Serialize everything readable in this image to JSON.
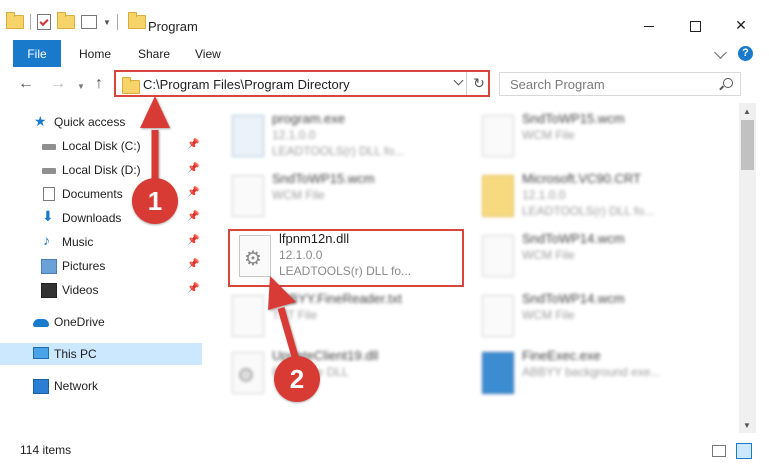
{
  "window": {
    "title": "Program",
    "controls": {
      "minimize": "",
      "maximize": "",
      "close": "✕"
    }
  },
  "ribbon": {
    "tabs": [
      "File",
      "Home",
      "Share",
      "View"
    ],
    "help": "?"
  },
  "navigation": {
    "back": "←",
    "forward": "→",
    "up": "↑",
    "address": "C:\\Program Files\\Program Directory",
    "refresh": "↻",
    "search_placeholder": "Search Program"
  },
  "sidebar": {
    "items": [
      {
        "label": "Quick access",
        "icon": "star-icon",
        "pinned": false
      },
      {
        "label": "Local Disk (C:)",
        "icon": "disk-icon",
        "pinned": true
      },
      {
        "label": "Local Disk (D:)",
        "icon": "disk-icon",
        "pinned": true
      },
      {
        "label": "Documents",
        "icon": "documents-icon",
        "pinned": true
      },
      {
        "label": "Downloads",
        "icon": "downloads-icon",
        "pinned": true
      },
      {
        "label": "Music",
        "icon": "music-icon",
        "pinned": true
      },
      {
        "label": "Pictures",
        "icon": "pictures-icon",
        "pinned": true
      },
      {
        "label": "Videos",
        "icon": "videos-icon",
        "pinned": true
      },
      {
        "label": "OneDrive",
        "icon": "onedrive-icon",
        "pinned": false
      },
      {
        "label": "This PC",
        "icon": "pc-icon",
        "pinned": false,
        "selected": true
      },
      {
        "label": "Network",
        "icon": "network-icon",
        "pinned": false
      }
    ],
    "pin_glyph": "📌"
  },
  "files": [
    {
      "name": "program.exe",
      "line2": "12.1.0.0",
      "line3": "LEADTOOLS(r) DLL fo...",
      "icon": "exe-file-icon"
    },
    {
      "name": "SndToWP15.wcm",
      "line2": "WCM File",
      "line3": "",
      "icon": "document-file-icon"
    },
    {
      "name": "SndToWP15.wcm",
      "line2": "WCM File",
      "line3": "",
      "icon": "document-file-icon"
    },
    {
      "name": "Microsoft.VC90.CRT",
      "line2": "12.1.0.0",
      "line3": "LEADTOOLS(r) DLL fo...",
      "icon": "folder-icon"
    },
    {
      "name": "lfpnm12n.dll",
      "line2": "12.1.0.0",
      "line3": "LEADTOOLS(r) DLL fo...",
      "icon": "dll-file-icon"
    },
    {
      "name": "SndToWP14.wcm",
      "line2": "WCM File",
      "line3": "",
      "icon": "document-file-icon"
    },
    {
      "name": "ABBYY.FineReader.txt",
      "line2": "TXT File",
      "line3": "",
      "icon": "document-file-icon"
    },
    {
      "name": "SndToWP14.wcm",
      "line2": "WCM File",
      "line3": "",
      "icon": "document-file-icon"
    },
    {
      "name": "UpdateClient19.dll",
      "line2": "Resource DLL",
      "line3": "",
      "icon": "dll-file-icon"
    },
    {
      "name": "FineExec.exe",
      "line2": "ABBYY background exe...",
      "line3": "",
      "icon": "exe-file-icon"
    }
  ],
  "status": {
    "item_count": "114 items"
  },
  "annotations": {
    "step1": "1",
    "step2": "2"
  },
  "colors": {
    "accent": "#1979ca",
    "highlight_red": "#d9453d",
    "selected_bg": "#cce8ff"
  }
}
